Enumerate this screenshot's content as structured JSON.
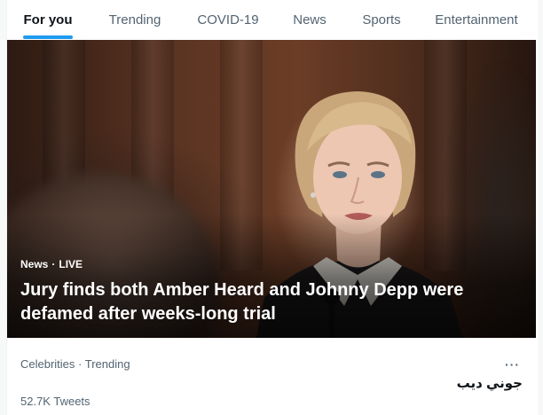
{
  "tabs": [
    {
      "label": "For you",
      "active": true
    },
    {
      "label": "Trending",
      "active": false
    },
    {
      "label": "COVID-19",
      "active": false
    },
    {
      "label": "News",
      "active": false
    },
    {
      "label": "Sports",
      "active": false
    },
    {
      "label": "Entertainment",
      "active": false
    }
  ],
  "hero": {
    "category": "News",
    "separator": "·",
    "status": "LIVE",
    "headline": "Jury finds both Amber Heard and Johnny Depp were defamed after weeks-long trial"
  },
  "trend": {
    "context": "Celebrities · Trending",
    "name": "جوني ديب",
    "tweet_count": "52.7K Tweets",
    "more_icon": "more-horizontal-icon"
  },
  "colors": {
    "accent": "#1d9bf0",
    "text_primary": "#0f1419",
    "text_secondary": "#536471"
  }
}
